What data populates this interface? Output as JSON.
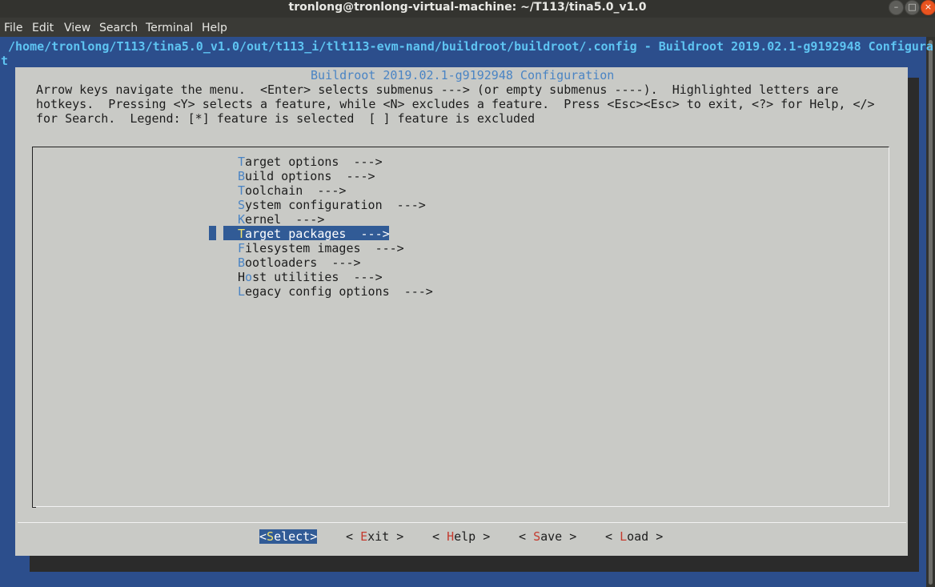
{
  "window": {
    "title": "tronlong@tronlong-virtual-machine: ~/T113/tina5.0_v1.0"
  },
  "menubar": {
    "items": [
      "File",
      "Edit",
      "View",
      "Search",
      "Terminal",
      "Help"
    ]
  },
  "terminal": {
    "path_line": "/home/tronlong/T113/tina5.0_v1.0/out/t113_i/tlt113-evm-nand/buildroot/buildroot/.config - Buildroot 2019.02.1-g9192948 Configura",
    "path_wrap": "t"
  },
  "dialog": {
    "title": " Buildroot 2019.02.1-g9192948 Configuration ",
    "help_lines": [
      "Arrow keys navigate the menu.  <Enter> selects submenus ---> (or empty submenus ----).  Highlighted letters are",
      "hotkeys.  Pressing <Y> selects a feature, while <N> excludes a feature.  Press <Esc><Esc> to exit, <?> for Help, </>",
      "for Search.  Legend: [*] feature is selected  [ ] feature is excluded"
    ],
    "menu_items": [
      {
        "hotkey": "T",
        "rest": "arget options  --->"
      },
      {
        "hotkey": "B",
        "rest": "uild options  --->"
      },
      {
        "hotkey": "T",
        "rest": "oolchain  --->"
      },
      {
        "hotkey": "S",
        "rest": "ystem configuration  --->"
      },
      {
        "hotkey": "K",
        "rest": "ernel  --->"
      },
      {
        "hotkey": "T",
        "rest": "arget packages  --->"
      },
      {
        "hotkey": "F",
        "rest": "ilesystem images  --->"
      },
      {
        "hotkey": "B",
        "rest": "ootloaders  --->"
      },
      {
        "prefix": "H",
        "hotkey": "o",
        "rest": "st utilities  --->"
      },
      {
        "hotkey": "L",
        "rest": "egacy config options  --->"
      }
    ],
    "selected_index": 5,
    "buttons": [
      {
        "pre": "<",
        "hotkey": "S",
        "rest": "elect",
        "post": ">"
      },
      {
        "pre": "< ",
        "hotkey": "E",
        "rest": "xit",
        "post": " >"
      },
      {
        "pre": "< ",
        "hotkey": "H",
        "rest": "elp",
        "post": " >"
      },
      {
        "pre": "< ",
        "hotkey": "S",
        "rest": "ave",
        "post": " >"
      },
      {
        "pre": "< ",
        "hotkey": "L",
        "rest": "oad",
        "post": " >"
      }
    ]
  },
  "colors": {
    "terminal_bg": "#2c4e8c",
    "dialog_bg": "#c9cac6",
    "highlight": "#315b96",
    "hotkey_blue": "#4a84c4",
    "hotkey_red": "#c43a2e",
    "hotkey_selected": "#f2e36e",
    "path_text": "#5ec4f2"
  }
}
